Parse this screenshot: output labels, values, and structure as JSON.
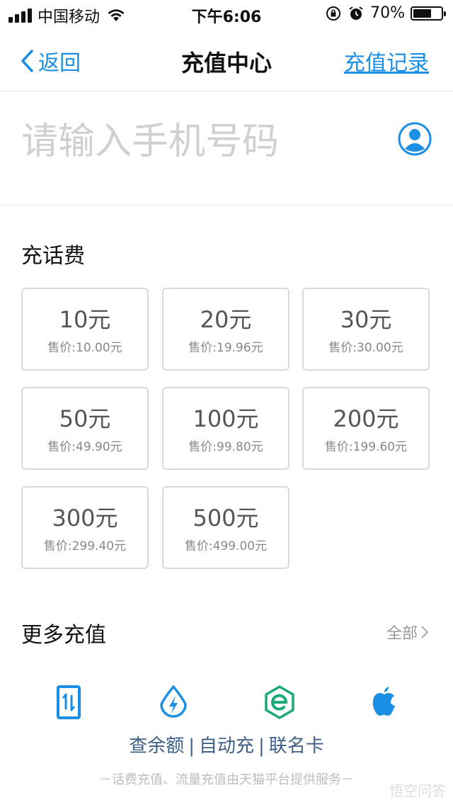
{
  "status_bar": {
    "carrier": "中国移动",
    "time": "下午6:06",
    "battery": "70%",
    "battery_level": 0.7
  },
  "nav": {
    "back_label": "返回",
    "title": "充值中心",
    "records_label": "充值记录"
  },
  "phone": {
    "placeholder": "请输入手机号码",
    "value": ""
  },
  "topup": {
    "title": "充话费",
    "options": [
      {
        "amount": "10元",
        "price": "售价:10.00元"
      },
      {
        "amount": "20元",
        "price": "售价:19.96元"
      },
      {
        "amount": "30元",
        "price": "售价:30.00元"
      },
      {
        "amount": "50元",
        "price": "售价:49.90元"
      },
      {
        "amount": "100元",
        "price": "售价:99.80元"
      },
      {
        "amount": "200元",
        "price": "售价:199.60元"
      },
      {
        "amount": "300元",
        "price": "售价:299.40元"
      },
      {
        "amount": "500元",
        "price": "售价:499.00元"
      }
    ]
  },
  "more": {
    "title": "更多充值",
    "all_label": "全部"
  },
  "links": {
    "balance": "查余额",
    "separator": "|",
    "auto": "自动充",
    "cobrand": "联名卡"
  },
  "footer": "－话费充值、流量充值由天猫平台提供服务－",
  "watermark": "悟空问答",
  "colors": {
    "accent": "#1a8fe3",
    "link_text": "#3d5f86",
    "card_border": "#d9d9d9",
    "green": "#1aa97b"
  }
}
